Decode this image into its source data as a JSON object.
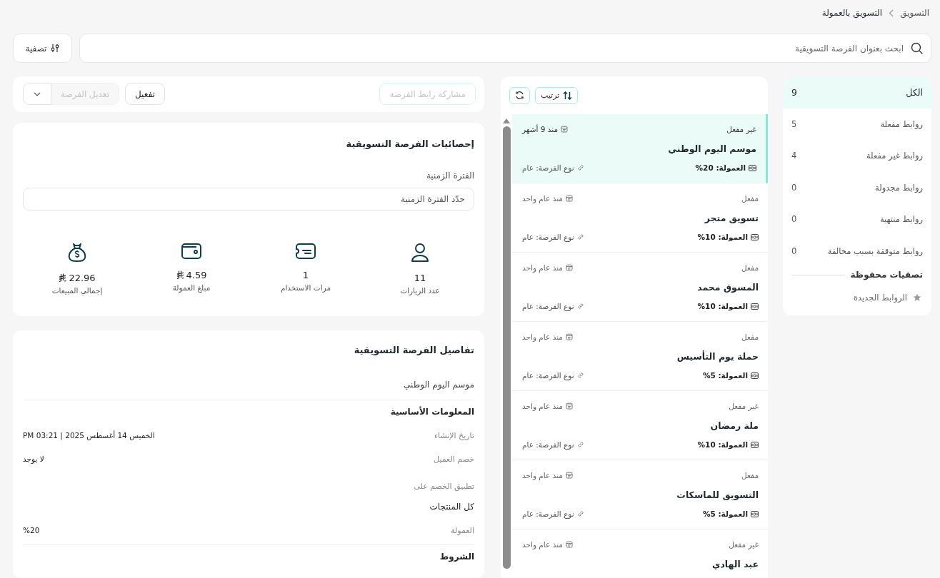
{
  "breadcrumb": [
    "التسويق",
    "التسويق بالعمولة"
  ],
  "search": {
    "placeholder": "ابحث بعنوان الفرصة التسويقية"
  },
  "filter_button": "تصفية",
  "sidebar": {
    "items": [
      {
        "label": "الكل",
        "count": "9",
        "selected": true
      },
      {
        "label": "روابط مفعلة",
        "count": "5",
        "selected": false
      },
      {
        "label": "روابط غير مفعلة",
        "count": "4",
        "selected": false
      },
      {
        "label": "روابط مجدولة",
        "count": "0",
        "selected": false
      },
      {
        "label": "روابط منتهية",
        "count": "0",
        "selected": false
      },
      {
        "label": "روابط متوقفة بسبب مخالفة",
        "count": "0",
        "selected": false
      }
    ],
    "saved_heading": "تصفيات محفوظة",
    "saved": [
      {
        "label": "الروابط الجديدة"
      }
    ]
  },
  "list": {
    "sort_button": "ترتيب",
    "items": [
      {
        "status": "غير مفعل",
        "time": "منذ 9 أشهر",
        "title": "موسم اليوم الوطني",
        "commission": "العمولة: 20%",
        "type": "نوع الفرصة: عام",
        "selected": true
      },
      {
        "status": "مفعل",
        "time": "منذ عام واحد",
        "title": "تسويق متجر",
        "commission": "العمولة: 10%",
        "type": "نوع الفرصة: عام",
        "selected": false
      },
      {
        "status": "مفعل",
        "time": "منذ عام واحد",
        "title": "المسوق محمد",
        "commission": "العمولة: 10%",
        "type": "نوع الفرصة: عام",
        "selected": false
      },
      {
        "status": "مفعل",
        "time": "منذ عام واحد",
        "title": "حملة يوم التأسيس",
        "commission": "العمولة: 5%",
        "type": "نوع الفرصة: عام",
        "selected": false
      },
      {
        "status": "غير مفعل",
        "time": "منذ عام واحد",
        "title": "ملة رمضان",
        "commission": "العمولة: 10%",
        "type": "نوع الفرصة: عام",
        "selected": false
      },
      {
        "status": "مفعل",
        "time": "منذ عام واحد",
        "title": "التسويق للماسكات",
        "commission": "العمولة: 5%",
        "type": "نوع الفرصة: عام",
        "selected": false
      },
      {
        "status": "غير مفعل",
        "time": "منذ عام واحد",
        "title": "عبد الهادي",
        "selected": false
      }
    ]
  },
  "actions": [
    {
      "label": "مشاركة رابط الفرصة",
      "kind": "share",
      "disabled": true
    },
    {
      "label": "تفعيل",
      "kind": "activate",
      "disabled": false
    },
    {
      "label": "تعديل الفرصة",
      "kind": "edit",
      "disabled": true
    }
  ],
  "stats": {
    "title": "إحصائيات الفرصة التسويقية",
    "period_label": "الفترة الزمنية",
    "period_placeholder": "حدّد الفترة الزمنية",
    "items": [
      {
        "kind": "visits",
        "value": "11",
        "label": "عدد الزيارات",
        "currency": false
      },
      {
        "kind": "uses",
        "value": "1",
        "label": "مرات الاستخدام",
        "currency": false
      },
      {
        "kind": "commission",
        "value": "4.59",
        "label": "مبلغ العمولة",
        "currency": true
      },
      {
        "kind": "sales",
        "value": "22.96",
        "label": "إجمالي المبيعات",
        "currency": true
      }
    ]
  },
  "details": {
    "title": "تفاصيل الفرصة التسويقية",
    "name": "موسم اليوم الوطني",
    "sections": [
      {
        "heading": "المعلومات الأساسية",
        "rows": [
          {
            "kind": "inline",
            "label": "تاريخ الإنشاء",
            "value": "الخميس 14 أغسطس 2025 | 03:21 PM"
          },
          {
            "kind": "inline",
            "label": "خصم العميل",
            "value": "لا يوجد"
          },
          {
            "kind": "stacked",
            "label": "تطبيق الخصم على",
            "value": "كل المنتجات"
          },
          {
            "kind": "inline",
            "label": "العمولة",
            "value": "%20"
          }
        ]
      },
      {
        "heading": "الشروط"
      }
    ]
  }
}
